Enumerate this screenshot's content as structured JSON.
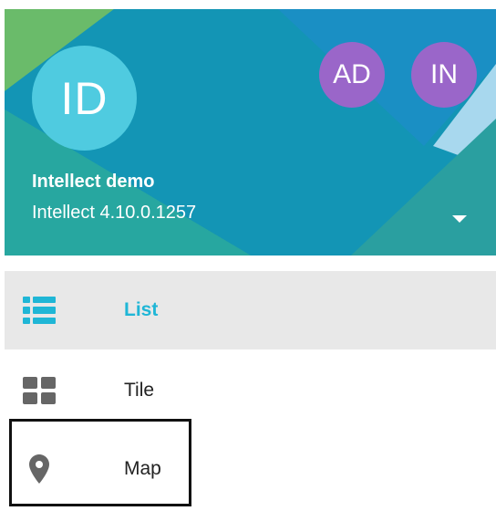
{
  "colors": {
    "header_base": "#2a9fa0",
    "avatar_main": "#4fcbe0",
    "avatar_secondary": "#9a66c9",
    "active_accent": "#1fb6d6",
    "active_bg": "#e8e8e8",
    "icon_gray": "#666666"
  },
  "account": {
    "avatar_initials": "ID",
    "name": "Intellect demo",
    "version": "Intellect 4.10.0.1257",
    "other_accounts": [
      {
        "initials": "AD"
      },
      {
        "initials": "IN"
      }
    ]
  },
  "menu": {
    "items": [
      {
        "label": "List",
        "icon": "list-icon",
        "active": true
      },
      {
        "label": "Tile",
        "icon": "tile-icon",
        "active": false
      },
      {
        "label": "Map",
        "icon": "map-pin-icon",
        "active": false
      }
    ]
  }
}
